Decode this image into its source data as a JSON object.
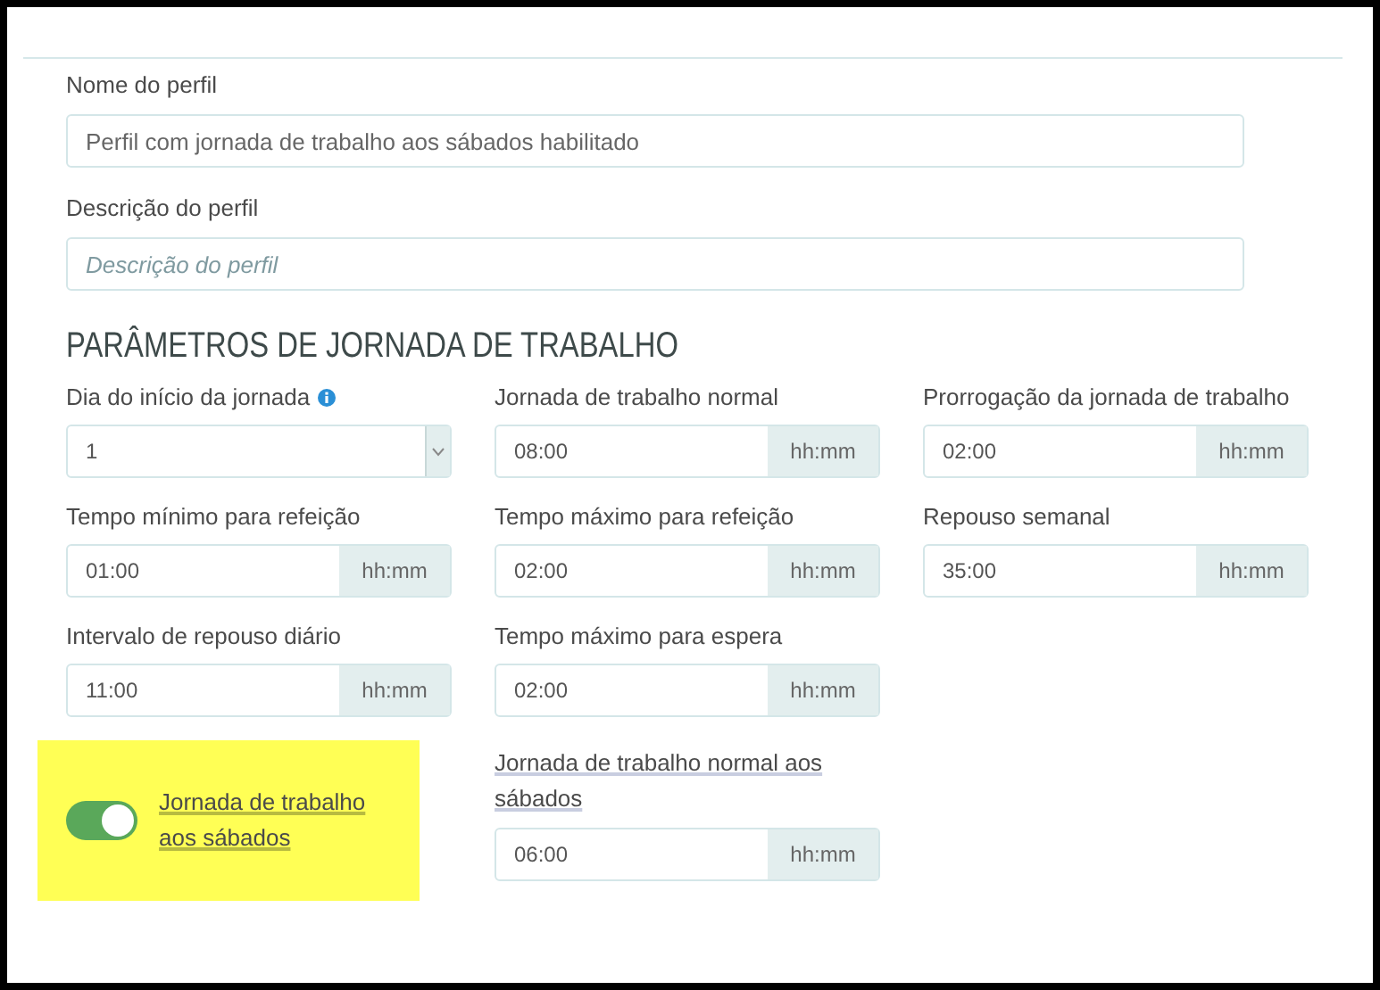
{
  "profile_name": {
    "label": "Nome do perfil",
    "value": "Perfil com jornada de trabalho aos sábados habilitado"
  },
  "description": {
    "label": "Descrição do perfil",
    "placeholder": "Descrição do perfil"
  },
  "section_title": "PARÂMETROS DE JORNADA DE TRABALHO",
  "rows": [
    [
      {
        "kind": "select",
        "label": "Dia do início da jornada",
        "info": true,
        "value": "1"
      },
      {
        "kind": "time",
        "label": "Jornada de trabalho normal",
        "value": "08:00",
        "unit": "hh:mm"
      },
      {
        "kind": "time",
        "label": "Prorrogação da jornada de trabalho",
        "value": "02:00",
        "unit": "hh:mm"
      }
    ],
    [
      {
        "kind": "time",
        "label": "Tempo mínimo para refeição",
        "value": "01:00",
        "unit": "hh:mm"
      },
      {
        "kind": "time",
        "label": "Tempo máximo para refeição",
        "value": "02:00",
        "unit": "hh:mm"
      },
      {
        "kind": "time",
        "label": "Repouso semanal",
        "value": "35:00",
        "unit": "hh:mm"
      }
    ],
    [
      {
        "kind": "time",
        "label": "Intervalo de repouso diário",
        "value": "11:00",
        "unit": "hh:mm"
      },
      {
        "kind": "time",
        "label": "Tempo máximo para espera",
        "value": "02:00",
        "unit": "hh:mm"
      }
    ],
    [
      {
        "kind": "toggle",
        "label": "Jornada de trabalho aos sábados",
        "on": true,
        "highlighted": true
      },
      {
        "kind": "time",
        "label": "Jornada de trabalho normal aos sábados",
        "value": "06:00",
        "unit": "hh:mm",
        "highlighted": true
      }
    ]
  ]
}
